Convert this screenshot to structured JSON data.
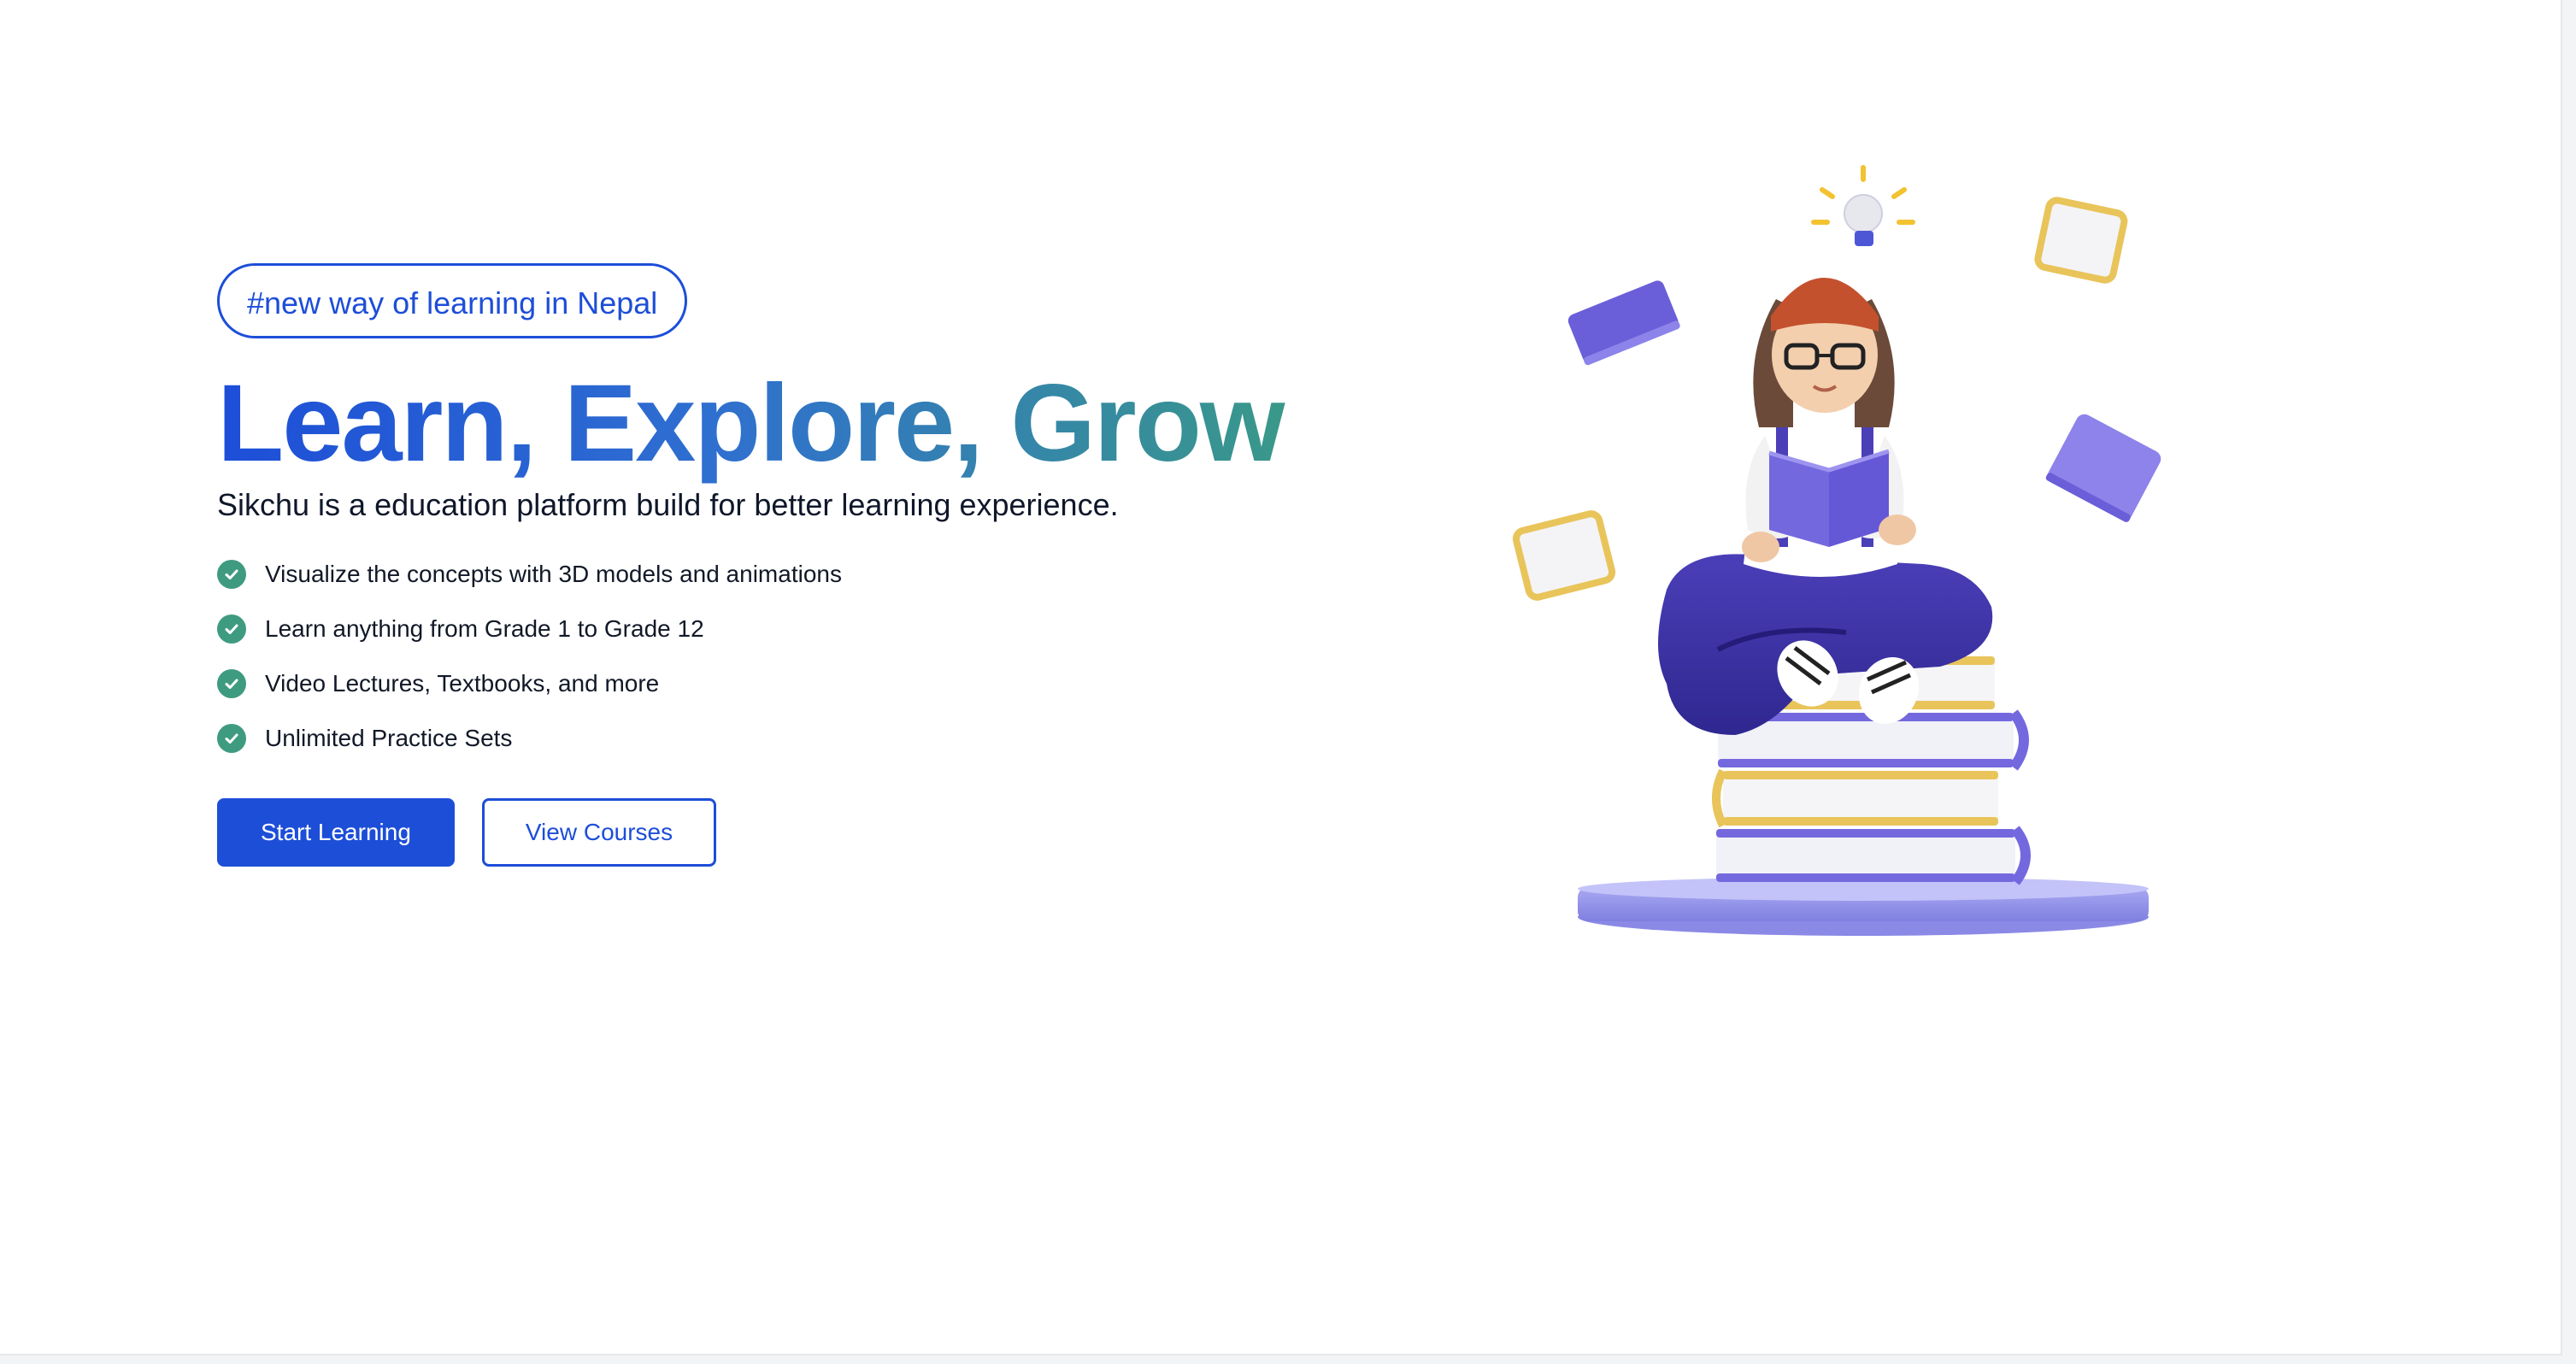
{
  "hero": {
    "badge": "#new way of learning in Nepal",
    "headline": "Learn, Explore, Grow",
    "subtitle": "Sikchu is a education platform build for better learning experience.",
    "features": [
      {
        "text": "Visualize the concepts with 3D models and animations",
        "icon": "check-circle-icon"
      },
      {
        "text": "Learn anything from Grade 1 to Grade 12",
        "icon": "check-circle-icon"
      },
      {
        "text": "Video Lectures, Textbooks, and more",
        "icon": "check-circle-icon"
      },
      {
        "text": "Unlimited Practice Sets",
        "icon": "check-circle-icon"
      }
    ],
    "primary_button": "Start Learning",
    "secondary_button": "View Courses"
  },
  "colors": {
    "brand_blue": "#1d4ed8",
    "brand_teal": "#3a9a86",
    "check_green": "#3f9b7f",
    "book_purple": "#7b6ee0",
    "book_gold": "#e8c45a"
  },
  "illustration": {
    "icon": "girl-reading-on-books-illustration"
  }
}
